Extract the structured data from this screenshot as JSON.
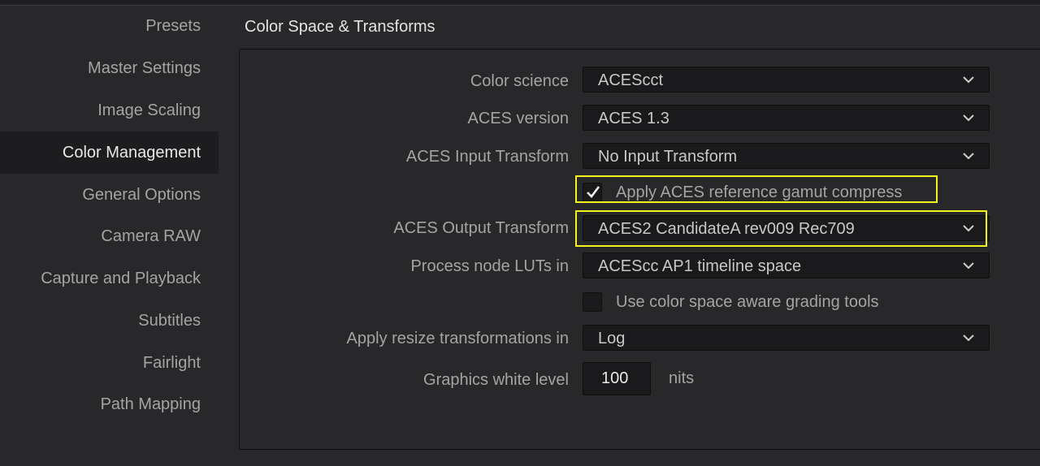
{
  "sidebar": {
    "items": [
      {
        "label": "Presets"
      },
      {
        "label": "Master Settings"
      },
      {
        "label": "Image Scaling"
      },
      {
        "label": "Color Management",
        "active": true
      },
      {
        "label": "General Options"
      },
      {
        "label": "Camera RAW"
      },
      {
        "label": "Capture and Playback"
      },
      {
        "label": "Subtitles"
      },
      {
        "label": "Fairlight"
      },
      {
        "label": "Path Mapping"
      }
    ]
  },
  "section": {
    "title": "Color Space & Transforms"
  },
  "settings": {
    "color_science": {
      "label": "Color science",
      "value": "ACEScct"
    },
    "aces_version": {
      "label": "ACES version",
      "value": "ACES 1.3"
    },
    "input_transform": {
      "label": "ACES Input Transform",
      "value": "No Input Transform"
    },
    "gamut_compress": {
      "label": "Apply ACES reference gamut compress",
      "checked": true
    },
    "output_transform": {
      "label": "ACES Output Transform",
      "value": "ACES2 CandidateA rev009 Rec709"
    },
    "node_luts": {
      "label": "Process node LUTs in",
      "value": "ACEScc AP1 timeline space"
    },
    "color_aware_tools": {
      "label": "Use color space aware grading tools",
      "checked": false
    },
    "resize_transform": {
      "label": "Apply resize transformations in",
      "value": "Log"
    },
    "white_level": {
      "label": "Graphics white level",
      "value": "100",
      "unit": "nits"
    }
  },
  "icons": {
    "dropdown": "chevron-down-icon",
    "check": "checkmark-icon"
  },
  "colors": {
    "highlight": "#f2f21d",
    "active_bg": "#1d1d1f",
    "panel_bg": "#28282b"
  }
}
